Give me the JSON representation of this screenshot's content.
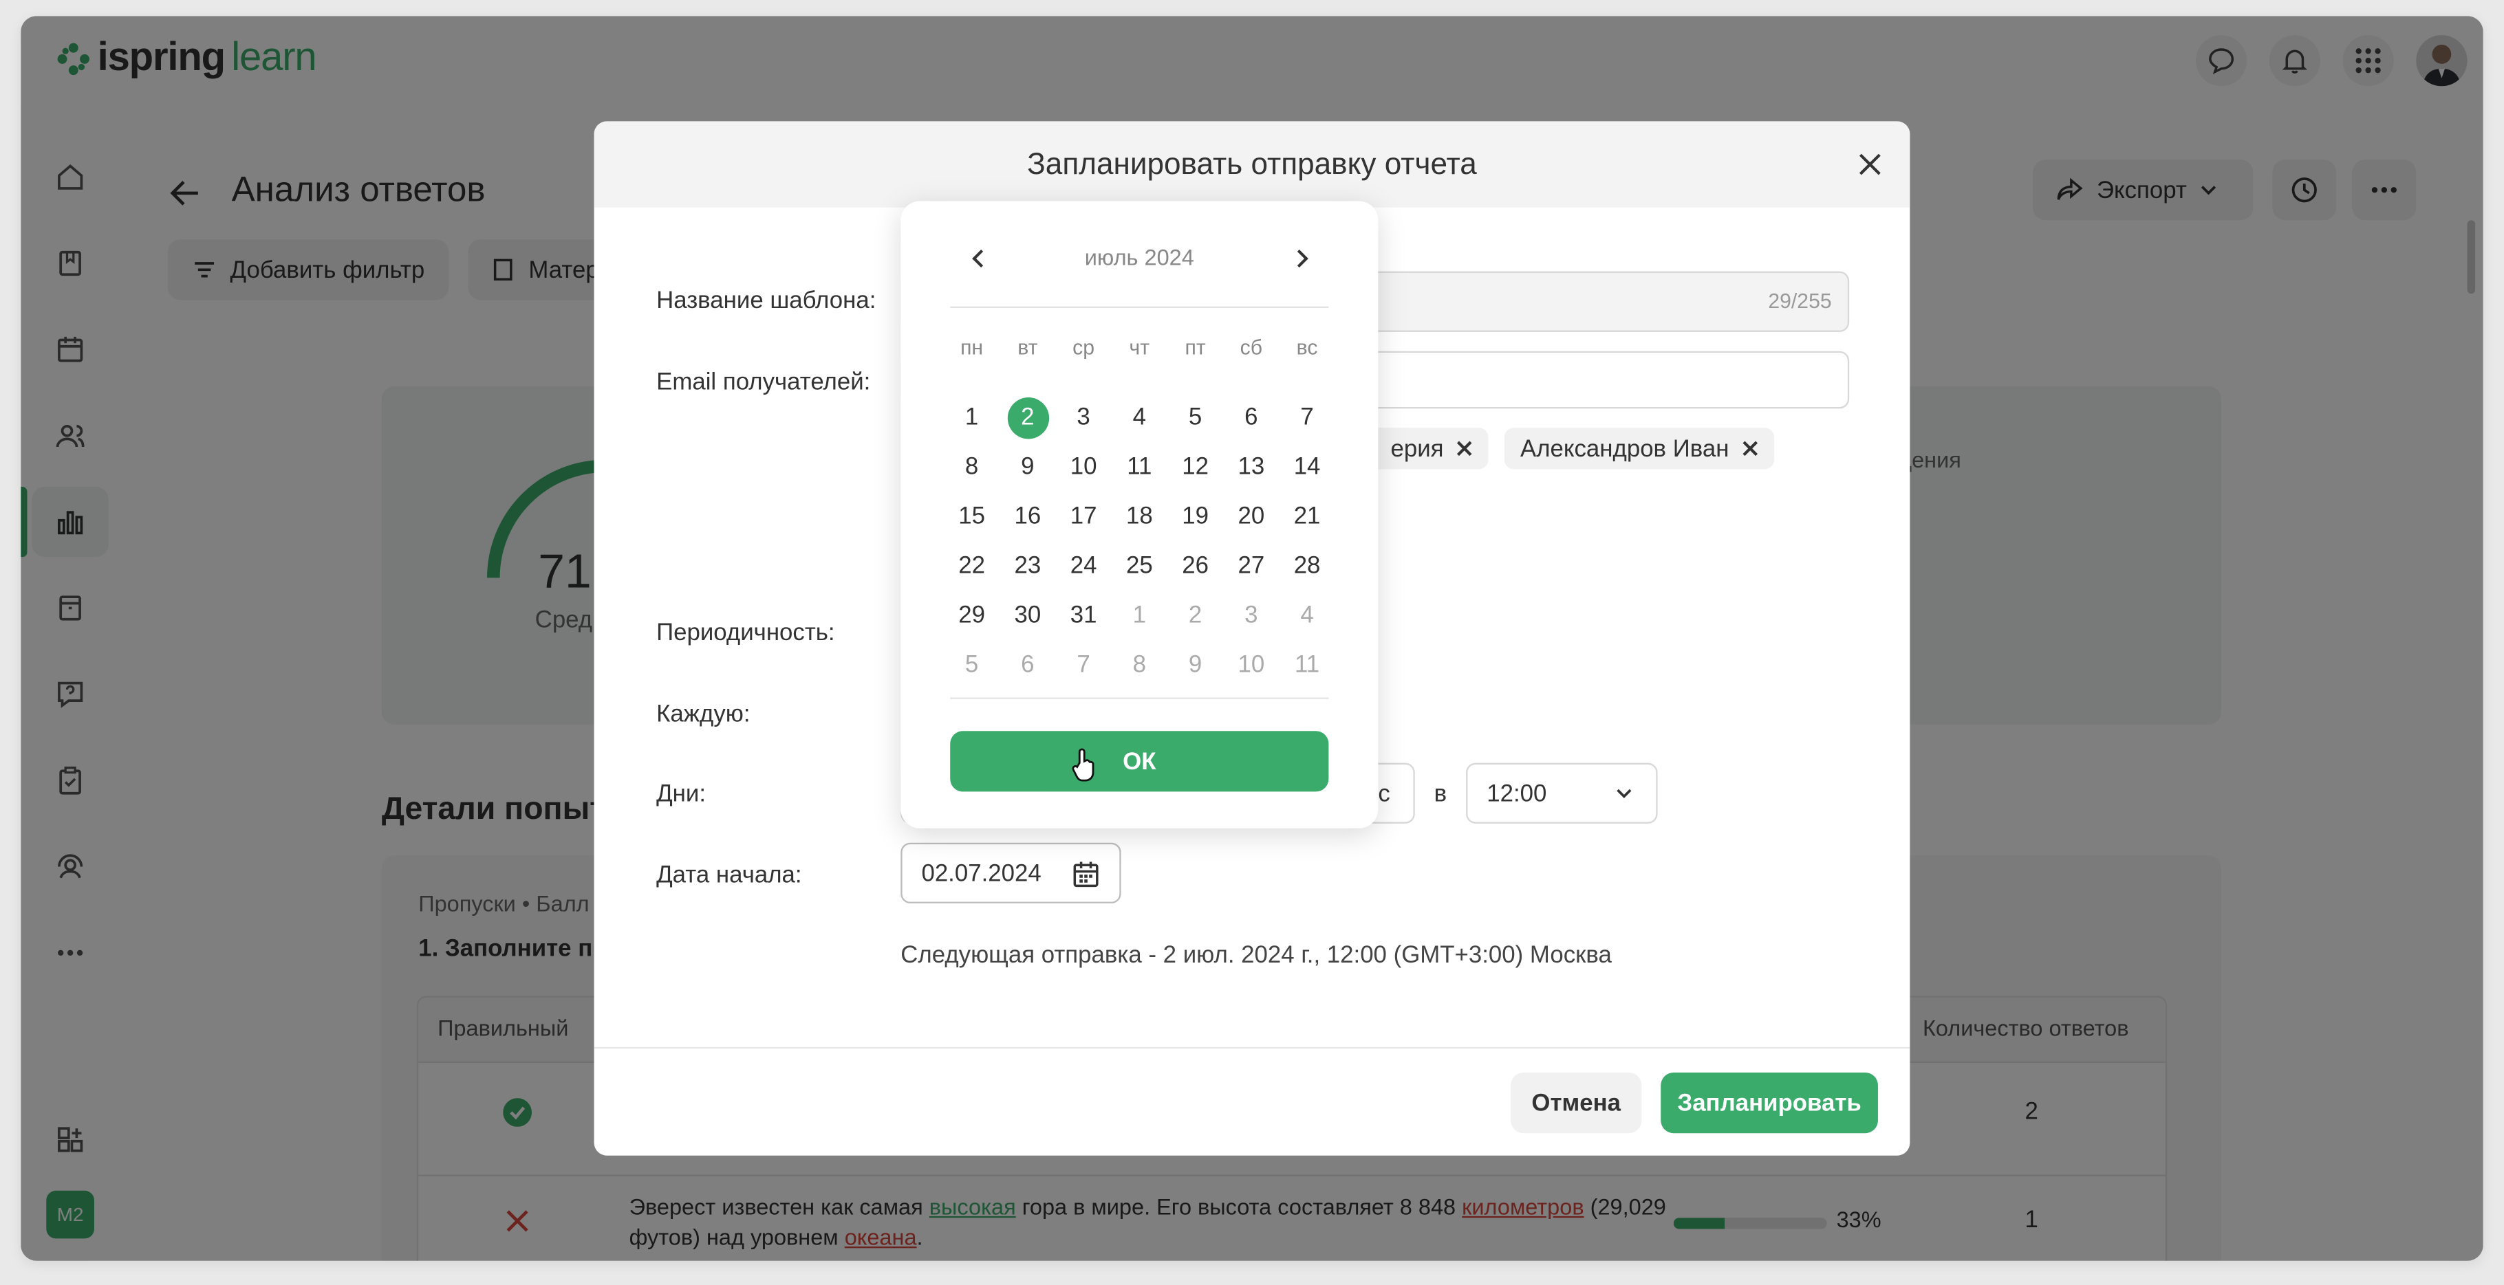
{
  "app": {
    "logo_part1": "ispring",
    "logo_part2": "learn",
    "badge": "M2",
    "icons": [
      "home-icon",
      "book-icon",
      "calendar-icon",
      "users-icon",
      "chart-icon",
      "archive-icon",
      "help-icon",
      "clipboard-icon",
      "support-icon",
      "more-icon",
      "add-widget-icon"
    ]
  },
  "page": {
    "title": "Анализ ответов",
    "export_label": "Экспорт",
    "add_filter": "Добавить фильтр",
    "materials_btn": "Матер",
    "score_value": "71.",
    "score_label": "Сред",
    "right_stat": "дения",
    "details_title": "Детали попыт",
    "breadcrumb_1": "Пропуски",
    "breadcrumb_2": "Балл",
    "question_title": "1. Заполните пр",
    "table": {
      "col_correct": "Правильный",
      "col_answers": "Количество ответов",
      "rows": [
        {
          "answers": "2"
        },
        {
          "text_a": "Эверест известен как самая ",
          "link_1": "высокая",
          "text_b": " гора в мире. Его высота составляет 8 848 ",
          "link_2": "километров",
          "text_c": " (29,029",
          "text_d": "футов) над уровнем ",
          "link_3": "океана",
          "text_e": ".",
          "percent": "33%",
          "percent_value": 33,
          "answers": "1"
        }
      ]
    }
  },
  "modal": {
    "title": "Запланировать отправку отчета",
    "template_label": "Название шаблона:",
    "template_counter": "29/255",
    "email_label": "Email получателей:",
    "chip_1": "ерия",
    "chip_2": "Александров Иван",
    "period_label": "Периодичность:",
    "each_label": "Каждую:",
    "days_label": "Дни:",
    "day_partial": "с",
    "at_label": "в",
    "time_value": "12:00",
    "start_label": "Дата начала:",
    "start_value": "02.07.2024",
    "next_send": "Следующая отправка - 2 июл. 2024 г., 12:00 (GMT+3:00) Москва",
    "cancel": "Отмена",
    "schedule": "Запланировать"
  },
  "calendar": {
    "month": "июль 2024",
    "weekdays": [
      "пн",
      "вт",
      "ср",
      "чт",
      "пт",
      "сб",
      "вс"
    ],
    "days": [
      {
        "n": "1"
      },
      {
        "n": "2",
        "sel": true
      },
      {
        "n": "3"
      },
      {
        "n": "4"
      },
      {
        "n": "5"
      },
      {
        "n": "6"
      },
      {
        "n": "7"
      },
      {
        "n": "8"
      },
      {
        "n": "9"
      },
      {
        "n": "10"
      },
      {
        "n": "11"
      },
      {
        "n": "12"
      },
      {
        "n": "13"
      },
      {
        "n": "14"
      },
      {
        "n": "15"
      },
      {
        "n": "16"
      },
      {
        "n": "17"
      },
      {
        "n": "18"
      },
      {
        "n": "19"
      },
      {
        "n": "20"
      },
      {
        "n": "21"
      },
      {
        "n": "22"
      },
      {
        "n": "23"
      },
      {
        "n": "24"
      },
      {
        "n": "25"
      },
      {
        "n": "26"
      },
      {
        "n": "27"
      },
      {
        "n": "28"
      },
      {
        "n": "29"
      },
      {
        "n": "30"
      },
      {
        "n": "31"
      },
      {
        "n": "1",
        "other": true
      },
      {
        "n": "2",
        "other": true
      },
      {
        "n": "3",
        "other": true
      },
      {
        "n": "4",
        "other": true
      },
      {
        "n": "5",
        "other": true
      },
      {
        "n": "6",
        "other": true
      },
      {
        "n": "7",
        "other": true
      },
      {
        "n": "8",
        "other": true
      },
      {
        "n": "9",
        "other": true
      },
      {
        "n": "10",
        "other": true
      },
      {
        "n": "11",
        "other": true
      }
    ],
    "ok": "ОК"
  },
  "colors": {
    "accent": "#3aab6a",
    "error": "#d9463b"
  }
}
